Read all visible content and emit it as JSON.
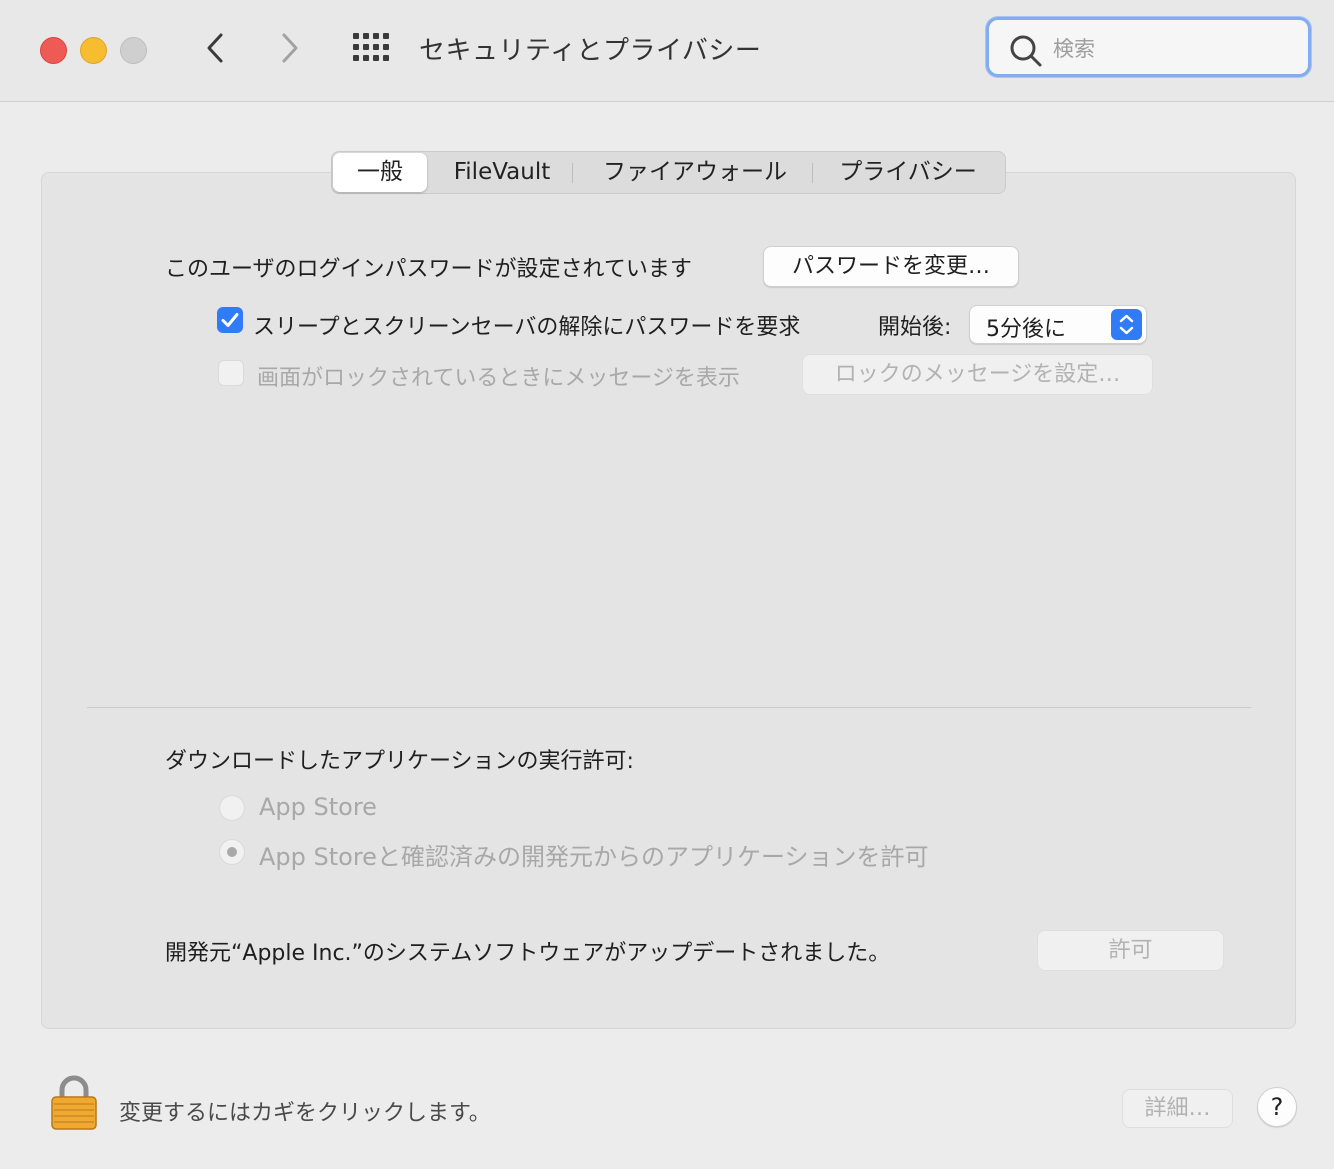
{
  "window": {
    "title": "セキュリティとプライバシー",
    "search_placeholder": "検索"
  },
  "tabs": [
    {
      "label": "一般",
      "selected": true
    },
    {
      "label": "FileVault",
      "selected": false
    },
    {
      "label": "ファイアウォール",
      "selected": false
    },
    {
      "label": "プライバシー",
      "selected": false
    }
  ],
  "general": {
    "login_password_text": "このユーザのログインパスワードが設定されています",
    "change_password_button": "パスワードを変更…",
    "require_password_label": "スリープとスクリーンセーバの解除にパスワードを要求",
    "require_password_checked": true,
    "after_label": "開始後:",
    "after_value": "5分後に",
    "lock_message_label": "画面がロックされているときにメッセージを表示",
    "lock_message_checked": false,
    "set_lock_message_button": "ロックのメッセージを設定…"
  },
  "downloads": {
    "heading": "ダウンロードしたアプリケーションの実行許可:",
    "options": [
      {
        "label": "App Store",
        "selected": false
      },
      {
        "label": "App Storeと確認済みの開発元からのアプリケーションを許可",
        "selected": true
      }
    ]
  },
  "system_software": {
    "message": "開発元“Apple Inc.”のシステムソフトウェアがアップデートされました。",
    "allow_button": "許可"
  },
  "footer": {
    "lock_text": "変更するにはカギをクリックします。",
    "advanced_button": "詳細…",
    "help_button": "?"
  },
  "colors": {
    "accent": "#2f7cf6",
    "close": "#ee5b55",
    "minimize": "#f7bd30",
    "zoom_inactive": "#cfcfcf",
    "lock": "#f0a830"
  }
}
